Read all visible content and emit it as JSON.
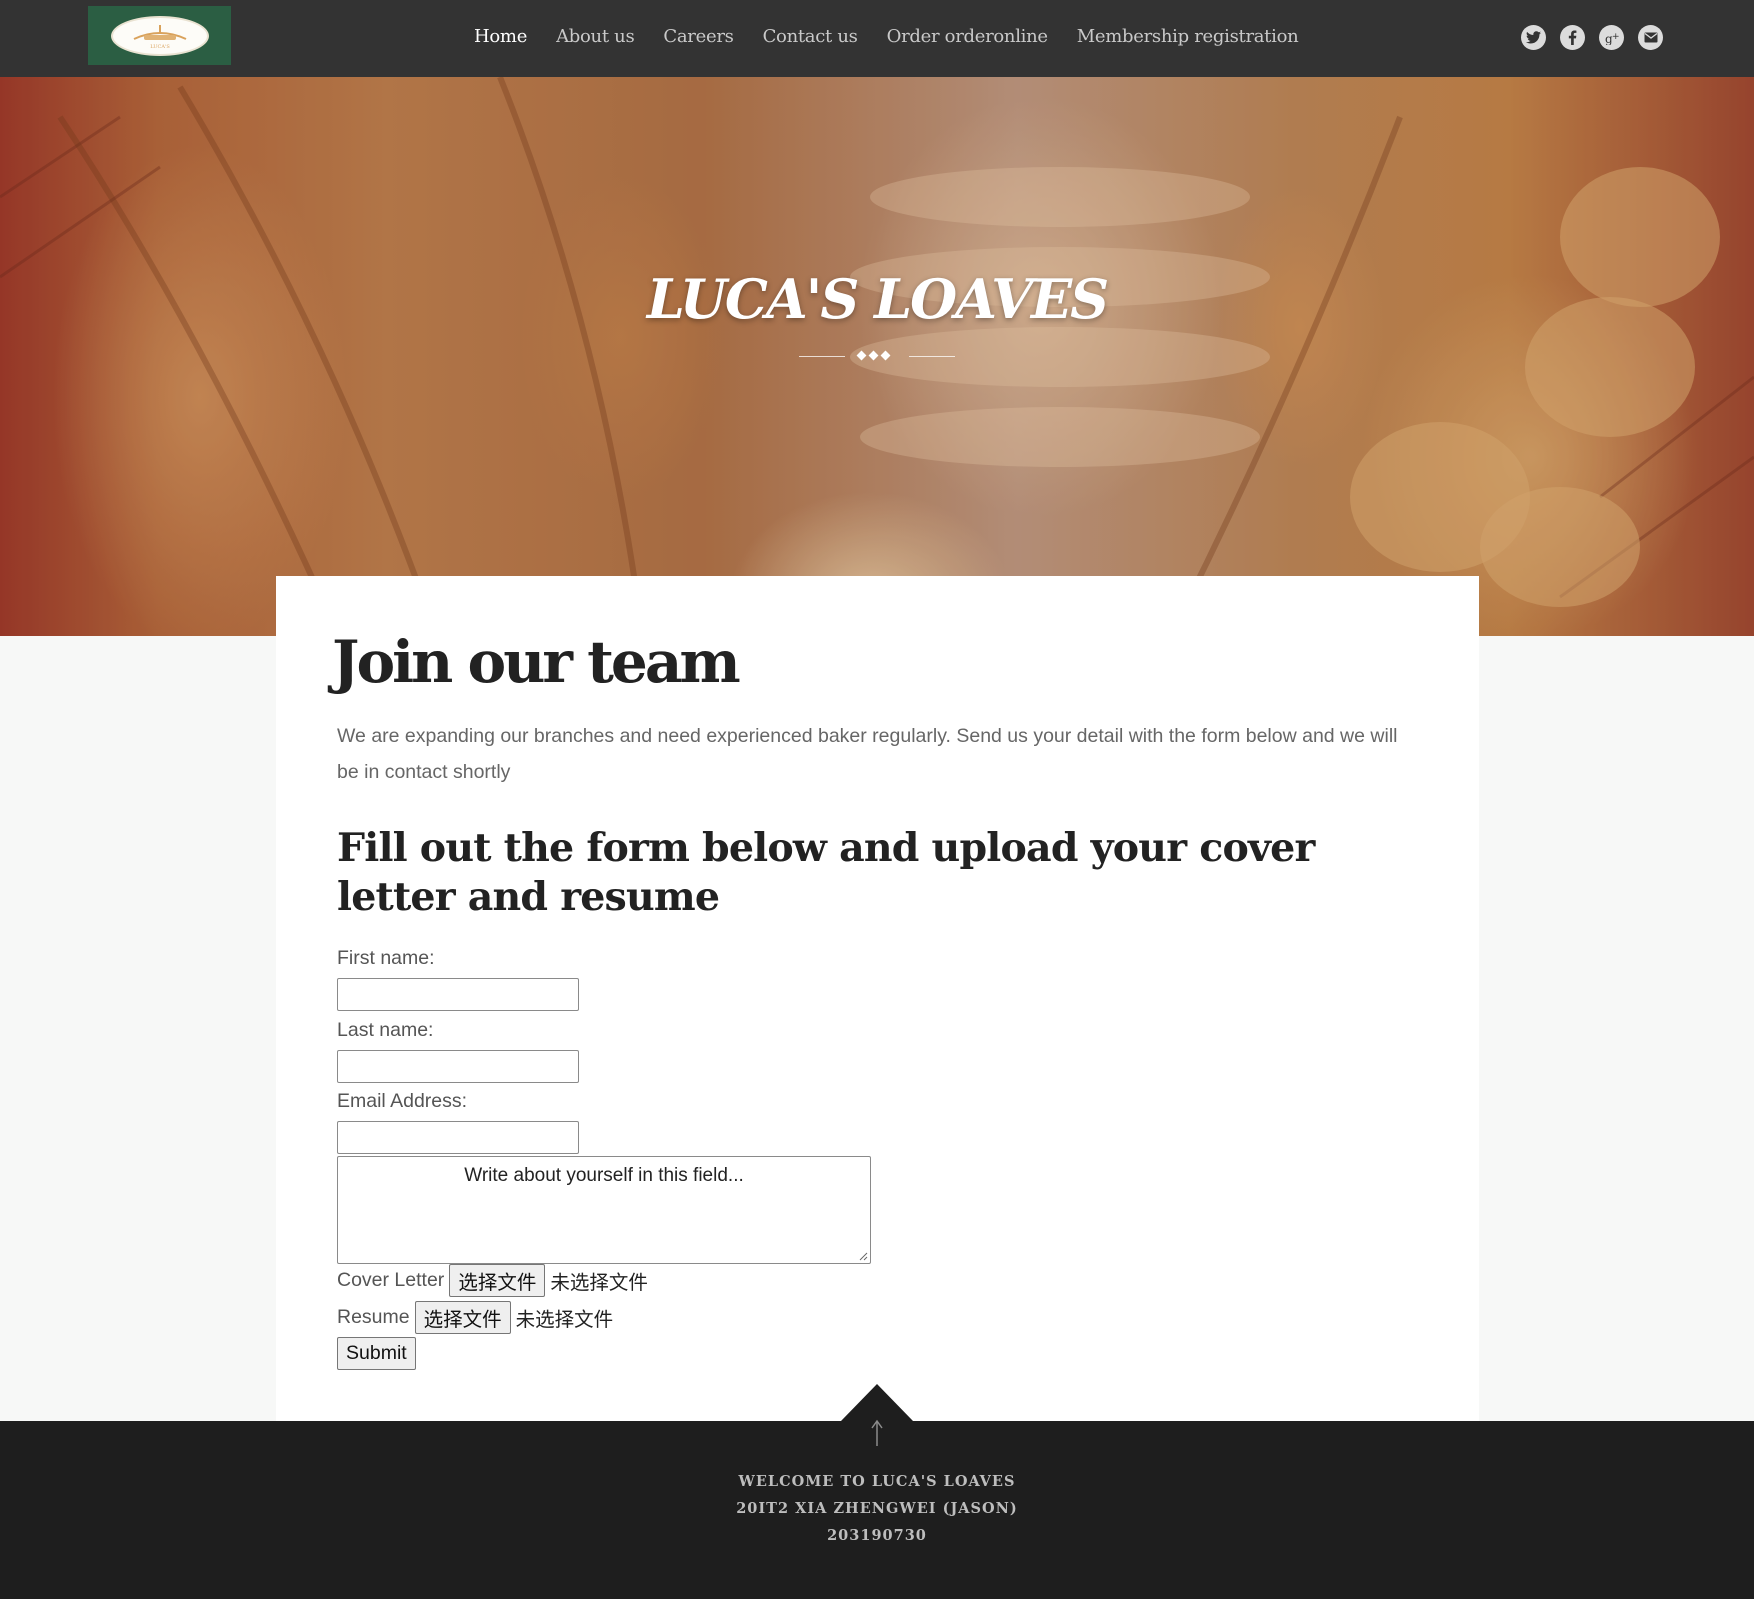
{
  "nav": {
    "logo_text": "LUCA'S",
    "links": [
      "Home",
      "About us",
      "Careers",
      "Contact us",
      "Order orderonline",
      "Membership registration"
    ],
    "active_index": 0,
    "social_icons": [
      "twitter-icon",
      "facebook-icon",
      "google-plus-icon",
      "mail-icon"
    ]
  },
  "hero": {
    "title": "LUCA'S LOAVES"
  },
  "main": {
    "title": "Join our team",
    "intro": "We are expanding our branches and need experienced baker regularly. Send us your detail with the form below and we will be in contact shortly",
    "form_heading": "Fill out the form below and upload your cover letter and resume",
    "form": {
      "first_name_label": "First name:",
      "last_name_label": "Last name:",
      "email_label": "Email Address:",
      "about_placeholder": "Write about yourself in this field...",
      "cover_letter_label": "Cover Letter",
      "resume_label": "Resume",
      "choose_file_label": "选择文件",
      "no_file_label": "未选择文件",
      "submit_label": "Submit"
    }
  },
  "footer": {
    "line1": "WELCOME TO LUCA'S LOAVES",
    "line2": "20IT2 XIA ZHENGWEI (JASON)",
    "line3": "203190730"
  },
  "colors": {
    "nav_bg": "#333333",
    "logo_bg": "#2b5e43",
    "footer_bg": "#1e1e1e",
    "page_bg": "#f7f8f7"
  }
}
